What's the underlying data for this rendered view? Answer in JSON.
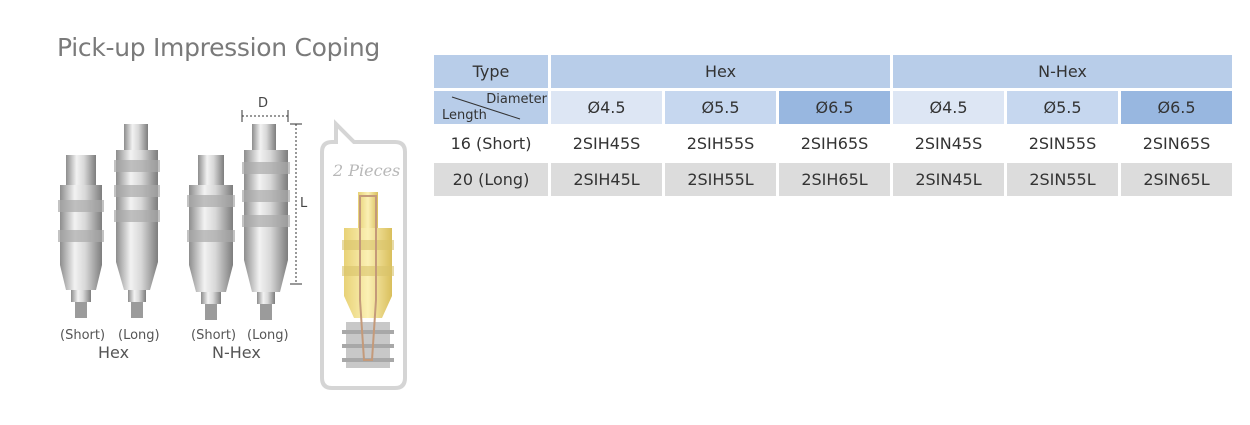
{
  "title": "Pick-up Impression Coping",
  "illustration": {
    "groups": [
      {
        "name": "Hex",
        "short_label": "(Short)",
        "long_label": "(Long)"
      },
      {
        "name": "N-Hex",
        "short_label": "(Short)",
        "long_label": "(Long)"
      }
    ],
    "dimension_d": "D",
    "dimension_l": "L",
    "pieces_label": "2 Pieces"
  },
  "table": {
    "type_header": "Type",
    "groups": [
      "Hex",
      "N-Hex"
    ],
    "diameter_label": "Diameter",
    "length_label": "Length",
    "diameters": [
      "Ø4.5",
      "Ø5.5",
      "Ø6.5",
      "Ø4.5",
      "Ø5.5",
      "Ø6.5"
    ],
    "rows": [
      {
        "length": "16 (Short)",
        "codes": [
          "2SIH45S",
          "2SIH55S",
          "2SIH65S",
          "2SIN45S",
          "2SIN55S",
          "2SIN65S"
        ]
      },
      {
        "length": "20 (Long)",
        "codes": [
          "2SIH45L",
          "2SIH55L",
          "2SIH65L",
          "2SIN45L",
          "2SIN55L",
          "2SIN65L"
        ]
      }
    ]
  },
  "colors": {
    "header_blue": "#b8cde9",
    "diameter_light": "#dde6f4",
    "diameter_mid": "#c6d7ef",
    "diameter_dark": "#98b7e0",
    "row_gray": "#dcdcdc"
  }
}
